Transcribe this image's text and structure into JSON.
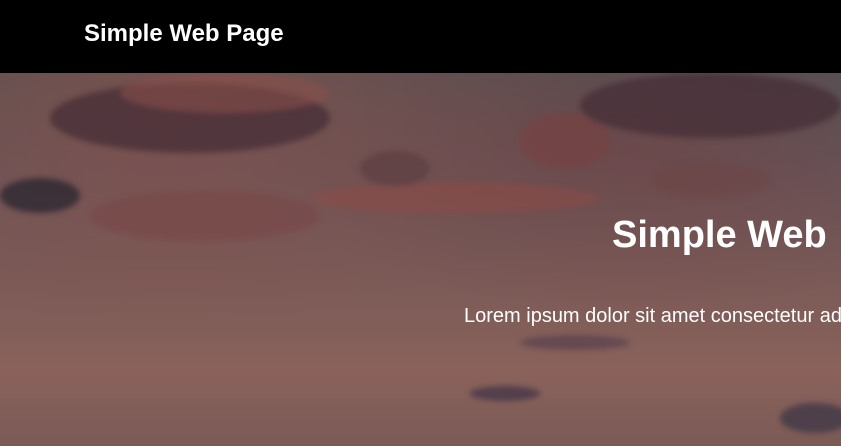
{
  "header": {
    "brand": "Simple Web Page"
  },
  "hero": {
    "title": "Simple Web",
    "text": "Lorem ipsum dolor sit amet consectetur ad"
  }
}
